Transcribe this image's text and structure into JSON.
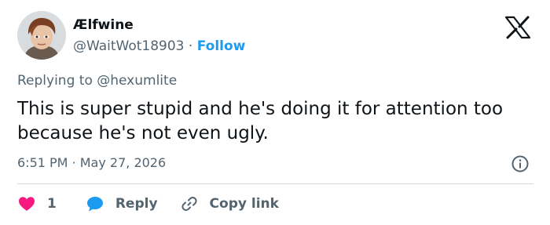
{
  "author": {
    "name": "Ælfwine",
    "handle": "@WaitWot18903",
    "separator": "·",
    "follow_label": "Follow"
  },
  "reply_context": {
    "prefix": "Replying to",
    "handle": "@hexumlite"
  },
  "tweet": {
    "text": "This is super stupid and he's doing it for attention too because he's not even ugly."
  },
  "meta": {
    "time": "6:51 PM",
    "separator": "·",
    "date": "May 27, 2026"
  },
  "actions": {
    "like_count": "1",
    "reply_label": "Reply",
    "copy_label": "Copy link"
  },
  "colors": {
    "accent": "#1d9bf0",
    "like": "#f91880",
    "text": "#0f1419",
    "secondary": "#536471",
    "divider": "#cfd9de"
  },
  "icons": {
    "logo": "x-logo-icon",
    "info": "info-icon",
    "like": "heart-icon",
    "reply": "speech-bubble-icon",
    "copy": "link-icon"
  }
}
